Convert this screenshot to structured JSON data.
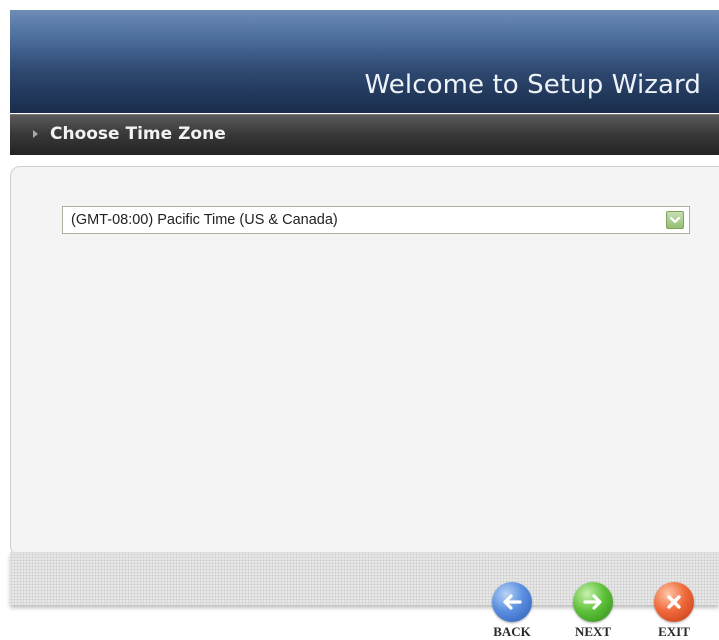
{
  "header": {
    "title": "Welcome to Setup Wizard"
  },
  "section": {
    "title": "Choose Time Zone"
  },
  "timezone": {
    "selected": "(GMT-08:00) Pacific Time (US & Canada)"
  },
  "nav": {
    "back_label": "BACK",
    "next_label": "NEXT",
    "exit_label": "EXIT"
  },
  "colors": {
    "header_dark": "#1a2d4c",
    "header_light": "#6d8db6",
    "section_bar": "#3a3a3a",
    "back": "#2a5cb5",
    "next": "#2f8a18",
    "exit": "#c2370f"
  },
  "icons": {
    "section": "arrow-right-icon",
    "dropdown": "chevron-down-icon",
    "back": "arrow-left-icon",
    "next": "arrow-right-icon",
    "exit": "close-icon"
  }
}
